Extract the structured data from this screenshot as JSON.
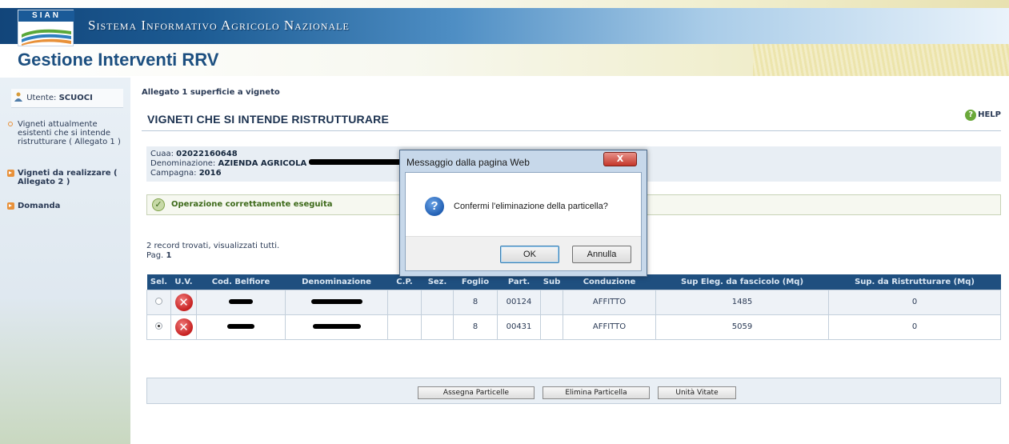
{
  "header": {
    "logo_text": "SIAN",
    "system_title": "Sistema Informativo Agricolo Nazionale",
    "app_title": "Gestione Interventi RRV"
  },
  "sidebar": {
    "user_label": "Utente:",
    "user_name": "SCUOCI",
    "items": [
      {
        "label": "Vigneti attualmente esistenti che si intende ristrutturare ( Allegato 1 )",
        "icon": "circle-bullet-icon"
      },
      {
        "label": "Vigneti da realizzare ( Allegato 2 )",
        "icon": "arrow-bullet-icon"
      },
      {
        "label": "Domanda",
        "icon": "arrow-bullet-icon"
      }
    ]
  },
  "main": {
    "allegato": "Allegato 1 superficie a vigneto",
    "page_title": "VIGNETI CHE SI INTENDE RISTRUTTURARE",
    "help_label": "HELP",
    "info": {
      "cuaa_label": "Cuaa:",
      "cuaa_value": "02022160648",
      "denominazione_label": "Denominazione:",
      "denominazione_value": "AZIENDA AGRICOLA",
      "campagna_label": "Campagna:",
      "campagna_value": "2016"
    },
    "success_message": "Operazione correttamente eseguita",
    "records_text": "2 record trovati, visualizzati tutti.",
    "page_label": "Pag.",
    "page_number": "1"
  },
  "table": {
    "headers": [
      "Sel.",
      "U.V.",
      "Cod. Belfiore",
      "Denominazione",
      "C.P.",
      "Sez.",
      "Foglio",
      "Part.",
      "Sub",
      "Conduzione",
      "Sup Eleg. da fascicolo (Mq)",
      "Sup. da Ristrutturare (Mq)"
    ],
    "rows": [
      {
        "selected": false,
        "foglio": "8",
        "part": "00124",
        "sub": "",
        "conduzione": "AFFITTO",
        "sup_eleg": "1485",
        "sup_ristr": "0"
      },
      {
        "selected": true,
        "foglio": "8",
        "part": "00431",
        "sub": "",
        "conduzione": "AFFITTO",
        "sup_eleg": "5059",
        "sup_ristr": "0"
      }
    ]
  },
  "buttons": {
    "assegna": "Assegna Particelle",
    "elimina": "Elimina Particella",
    "unita": "Unità Vitate"
  },
  "dialog": {
    "title": "Messaggio dalla pagina Web",
    "close_symbol": "X",
    "icon_symbol": "?",
    "message": "Confermi l'eliminazione della particella?",
    "ok_label": "OK",
    "cancel_label": "Annulla"
  },
  "colors": {
    "header_blue": "#1f4f7f",
    "title_blue": "#1c4f80",
    "accent_orange": "#e8913a",
    "success_green": "#3d6a1a",
    "delete_red": "#c62020"
  }
}
